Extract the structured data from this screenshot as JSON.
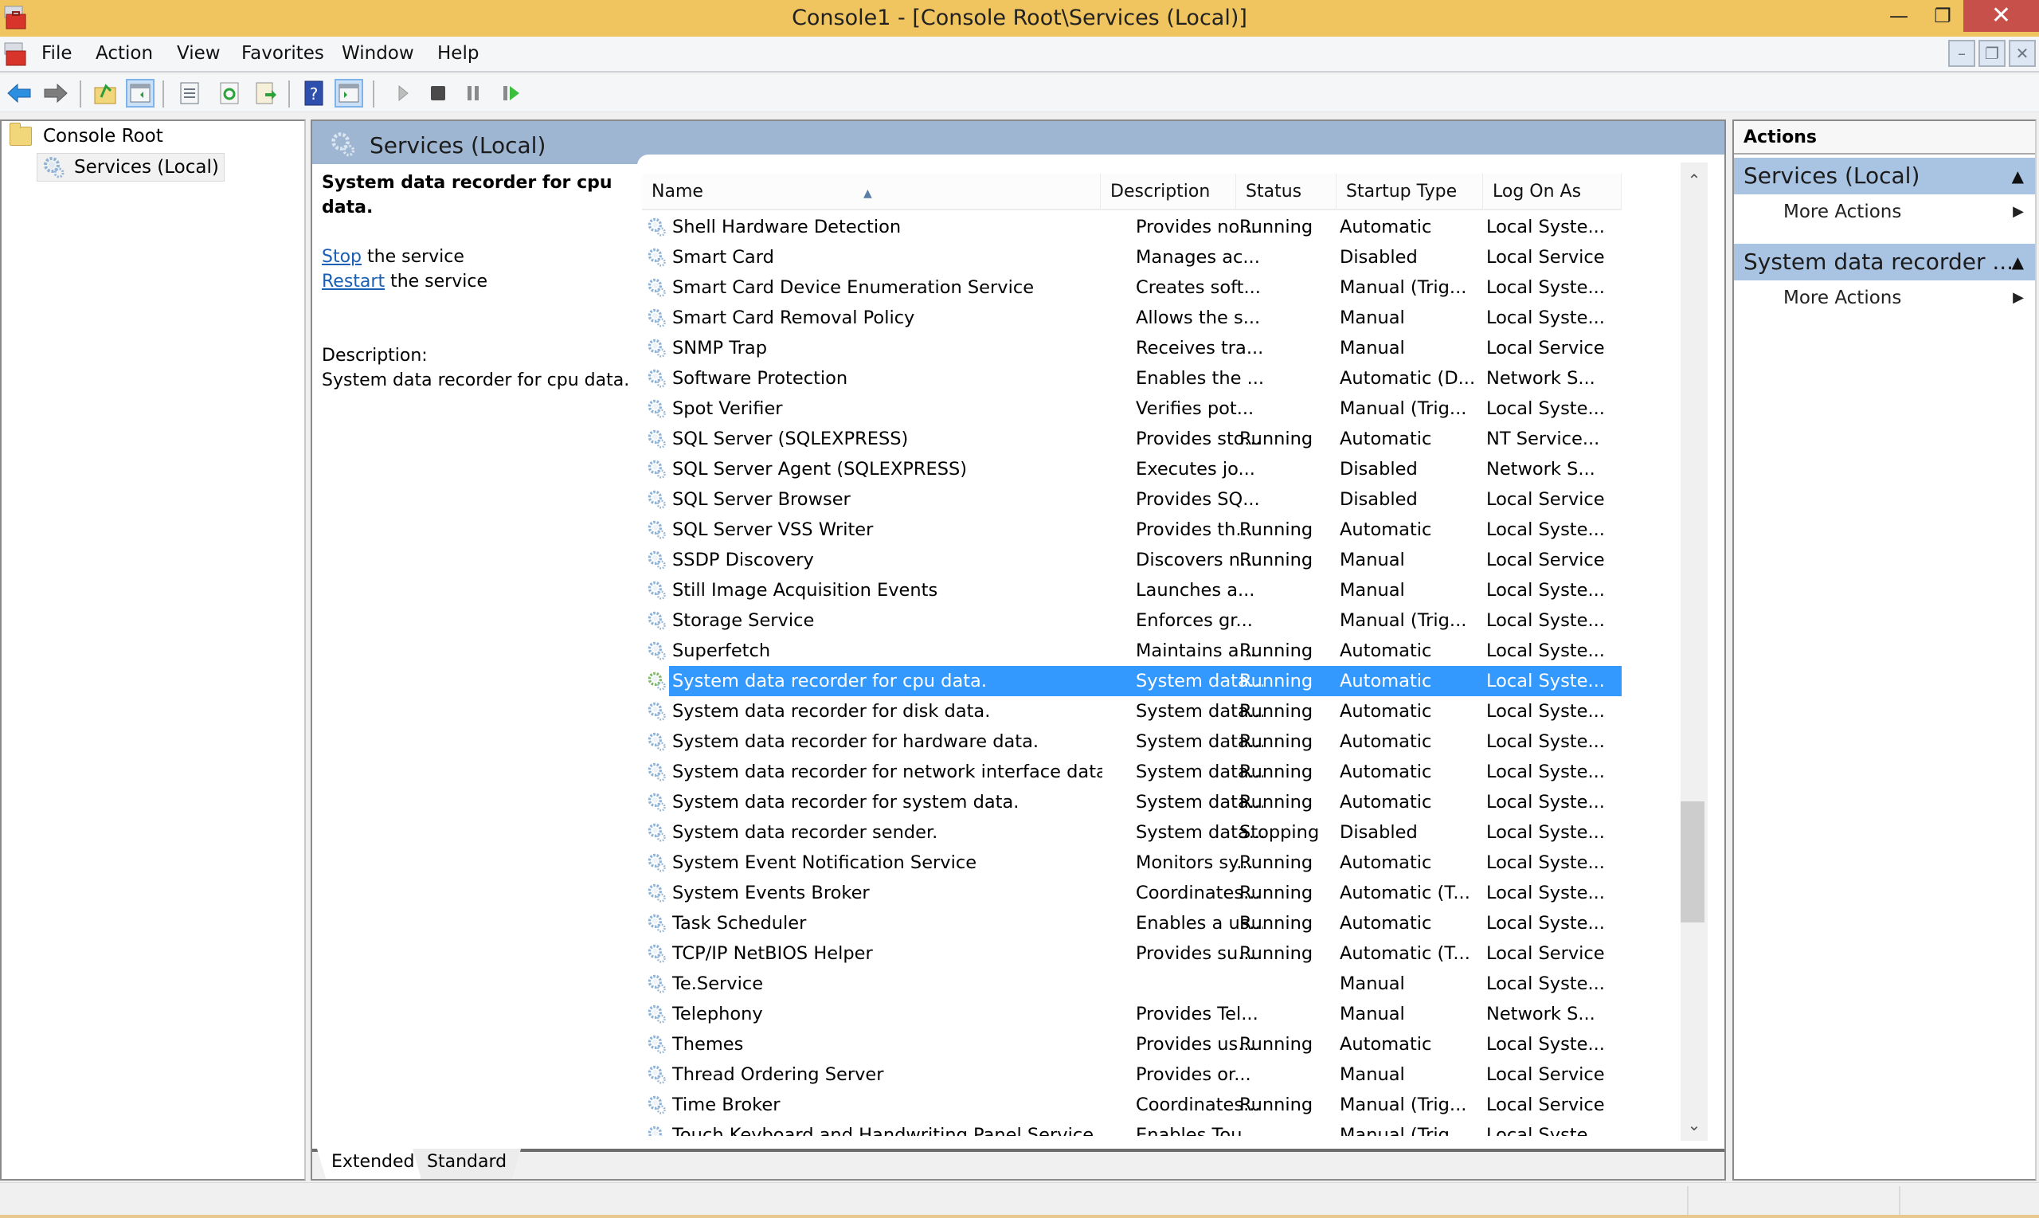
{
  "window": {
    "title": "Console1 - [Console Root\\Services (Local)]",
    "icon": "toolbox-icon",
    "controls": {
      "minimize": "—",
      "maximize": "❐",
      "close": "✕"
    }
  },
  "menubar": {
    "items": [
      "File",
      "Action",
      "View",
      "Favorites",
      "Window",
      "Help"
    ],
    "mdi_controls": {
      "minimize": "–",
      "restore": "❐",
      "close": "✕"
    }
  },
  "toolbar": {
    "buttons": [
      {
        "name": "back",
        "icon": "arrow-left-icon"
      },
      {
        "name": "forward",
        "icon": "arrow-right-icon"
      },
      {
        "name": "up-one-level",
        "icon": "folder-up-icon"
      },
      {
        "name": "show-hide-console-tree",
        "icon": "console-tree-icon",
        "pressed": true
      },
      {
        "name": "properties",
        "icon": "properties-icon"
      },
      {
        "name": "refresh",
        "icon": "refresh-icon"
      },
      {
        "name": "export-list",
        "icon": "export-list-icon"
      },
      {
        "name": "help",
        "icon": "help-icon"
      },
      {
        "name": "show-hide-action-pane",
        "icon": "action-pane-icon",
        "pressed": true
      },
      {
        "name": "start-service",
        "icon": "play-icon"
      },
      {
        "name": "stop-service",
        "icon": "stop-icon"
      },
      {
        "name": "pause-service",
        "icon": "pause-icon"
      },
      {
        "name": "restart-service",
        "icon": "resume-icon"
      }
    ]
  },
  "tree": {
    "root": "Console Root",
    "child": "Services (Local)"
  },
  "main": {
    "header_title": "Services (Local)",
    "detail": {
      "title": "System data recorder for cpu data.",
      "stop_link": "Stop",
      "stop_suffix": " the service",
      "restart_link": "Restart",
      "restart_suffix": " the service",
      "description_label": "Description:",
      "description_text": "System data recorder for cpu data."
    },
    "columns": [
      "Name",
      "Description",
      "Status",
      "Startup Type",
      "Log On As"
    ],
    "sort_indicator": "▲",
    "rows": [
      {
        "name": "Shell Hardware Detection",
        "description": "Provides no...",
        "status": "Running",
        "startup": "Automatic",
        "logon": "Local Syste..."
      },
      {
        "name": "Smart Card",
        "description": "Manages ac...",
        "status": "",
        "startup": "Disabled",
        "logon": "Local Service"
      },
      {
        "name": "Smart Card Device Enumeration Service",
        "description": "Creates soft...",
        "status": "",
        "startup": "Manual (Trig...",
        "logon": "Local Syste..."
      },
      {
        "name": "Smart Card Removal Policy",
        "description": "Allows the s...",
        "status": "",
        "startup": "Manual",
        "logon": "Local Syste..."
      },
      {
        "name": "SNMP Trap",
        "description": "Receives tra...",
        "status": "",
        "startup": "Manual",
        "logon": "Local Service"
      },
      {
        "name": "Software Protection",
        "description": "Enables the ...",
        "status": "",
        "startup": "Automatic (D...",
        "logon": "Network S..."
      },
      {
        "name": "Spot Verifier",
        "description": "Verifies pot...",
        "status": "",
        "startup": "Manual (Trig...",
        "logon": "Local Syste..."
      },
      {
        "name": "SQL Server (SQLEXPRESS)",
        "description": "Provides sto...",
        "status": "Running",
        "startup": "Automatic",
        "logon": "NT Service..."
      },
      {
        "name": "SQL Server Agent (SQLEXPRESS)",
        "description": "Executes jo...",
        "status": "",
        "startup": "Disabled",
        "logon": "Network S..."
      },
      {
        "name": "SQL Server Browser",
        "description": "Provides SQ...",
        "status": "",
        "startup": "Disabled",
        "logon": "Local Service"
      },
      {
        "name": "SQL Server VSS Writer",
        "description": "Provides th...",
        "status": "Running",
        "startup": "Automatic",
        "logon": "Local Syste..."
      },
      {
        "name": "SSDP Discovery",
        "description": "Discovers n...",
        "status": "Running",
        "startup": "Manual",
        "logon": "Local Service"
      },
      {
        "name": "Still Image Acquisition Events",
        "description": "Launches a...",
        "status": "",
        "startup": "Manual",
        "logon": "Local Syste..."
      },
      {
        "name": "Storage Service",
        "description": "Enforces gr...",
        "status": "",
        "startup": "Manual (Trig...",
        "logon": "Local Syste..."
      },
      {
        "name": "Superfetch",
        "description": "Maintains a...",
        "status": "Running",
        "startup": "Automatic",
        "logon": "Local Syste..."
      },
      {
        "name": "System data recorder for cpu data.",
        "description": "System data...",
        "status": "Running",
        "startup": "Automatic",
        "logon": "Local Syste...",
        "selected": true
      },
      {
        "name": "System data recorder for disk data.",
        "description": "System data...",
        "status": "Running",
        "startup": "Automatic",
        "logon": "Local Syste..."
      },
      {
        "name": "System data recorder for hardware data.",
        "description": "System data...",
        "status": "Running",
        "startup": "Automatic",
        "logon": "Local Syste..."
      },
      {
        "name": "System data recorder for network interface data.",
        "description": "System data...",
        "status": "Running",
        "startup": "Automatic",
        "logon": "Local Syste..."
      },
      {
        "name": "System data recorder for system data.",
        "description": "System data...",
        "status": "Running",
        "startup": "Automatic",
        "logon": "Local Syste..."
      },
      {
        "name": "System data recorder sender.",
        "description": "System data...",
        "status": "Stopping",
        "startup": "Disabled",
        "logon": "Local Syste..."
      },
      {
        "name": "System Event Notification Service",
        "description": "Monitors sy...",
        "status": "Running",
        "startup": "Automatic",
        "logon": "Local Syste..."
      },
      {
        "name": "System Events Broker",
        "description": "Coordinates...",
        "status": "Running",
        "startup": "Automatic (T...",
        "logon": "Local Syste..."
      },
      {
        "name": "Task Scheduler",
        "description": "Enables a us...",
        "status": "Running",
        "startup": "Automatic",
        "logon": "Local Syste..."
      },
      {
        "name": "TCP/IP NetBIOS Helper",
        "description": "Provides su...",
        "status": "Running",
        "startup": "Automatic (T...",
        "logon": "Local Service"
      },
      {
        "name": "Te.Service",
        "description": "",
        "status": "",
        "startup": "Manual",
        "logon": "Local Syste..."
      },
      {
        "name": "Telephony",
        "description": "Provides Tel...",
        "status": "",
        "startup": "Manual",
        "logon": "Network S..."
      },
      {
        "name": "Themes",
        "description": "Provides us...",
        "status": "Running",
        "startup": "Automatic",
        "logon": "Local Syste..."
      },
      {
        "name": "Thread Ordering Server",
        "description": "Provides or...",
        "status": "",
        "startup": "Manual",
        "logon": "Local Service"
      },
      {
        "name": "Time Broker",
        "description": "Coordinates...",
        "status": "Running",
        "startup": "Manual (Trig...",
        "logon": "Local Service"
      },
      {
        "name": "Touch Keyboard and Handwriting Panel Service",
        "description": "Enables Tou...",
        "status": "",
        "startup": "Manual (Trig...",
        "logon": "Local Syste..."
      },
      {
        "name": "",
        "description": "",
        "status": "",
        "startup": "",
        "logon": ""
      }
    ],
    "tabs": [
      "Extended",
      "Standard"
    ],
    "active_tab": "Extended",
    "scroll_position_fraction": 0.7
  },
  "actions": {
    "title": "Actions",
    "groups": [
      {
        "title": "Services (Local)",
        "items": [
          "More Actions"
        ]
      },
      {
        "title": "System data recorder ...",
        "items": [
          "More Actions"
        ]
      }
    ]
  },
  "colors": {
    "titlebar": "#f0c45e",
    "close_button": "#c7504a",
    "selection": "#3399ff",
    "pane_header": "#9fb6d3",
    "action_group": "#a9c3e3",
    "link": "#1a5fb4"
  }
}
